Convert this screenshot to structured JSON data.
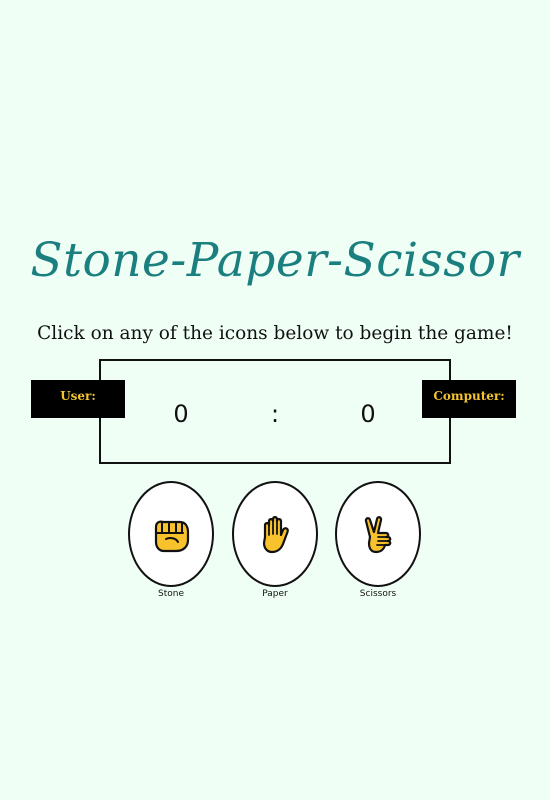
{
  "title": "Stone-Paper-Scissor",
  "instruction": "Click on any of the icons below to begin the game!",
  "scoreboard": {
    "user_label": "User:",
    "computer_label": "Computer:",
    "user_score": "0",
    "separator": ":",
    "computer_score": "0"
  },
  "choices": [
    {
      "label": "Stone",
      "icon": "fist-icon"
    },
    {
      "label": "Paper",
      "icon": "raised-hand-icon"
    },
    {
      "label": "Scissors",
      "icon": "victory-hand-icon"
    }
  ],
  "colors": {
    "background": "#effff6",
    "title": "#1b7f7f",
    "badge_bg": "#000000",
    "badge_text": "#f4c430",
    "icon_fill": "#f8c22d"
  }
}
